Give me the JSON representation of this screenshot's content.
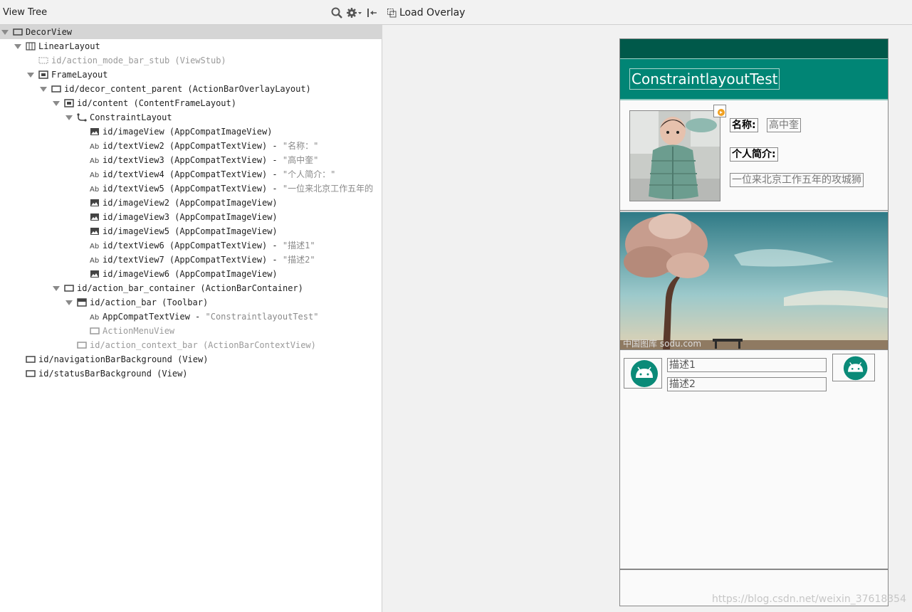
{
  "left_panel": {
    "title": "View Tree"
  },
  "right_panel": {
    "load_overlay_label": "Load Overlay"
  },
  "tree": [
    {
      "indent": 0,
      "arrow": true,
      "icon": "view-icon",
      "label": "DecorView",
      "string": "",
      "dim": false,
      "selected": true
    },
    {
      "indent": 1,
      "arrow": true,
      "icon": "linear-layout-icon",
      "label": "LinearLayout",
      "string": "",
      "dim": false
    },
    {
      "indent": 2,
      "arrow": false,
      "icon": "viewstub-icon",
      "label": "id/action_mode_bar_stub (ViewStub)",
      "string": "",
      "dim": true
    },
    {
      "indent": 2,
      "arrow": true,
      "icon": "frame-layout-icon",
      "label": "FrameLayout",
      "string": "",
      "dim": false
    },
    {
      "indent": 3,
      "arrow": true,
      "icon": "view-icon",
      "label": "id/decor_content_parent (ActionBarOverlayLayout)",
      "string": "",
      "dim": false
    },
    {
      "indent": 4,
      "arrow": true,
      "icon": "frame-layout-icon",
      "label": "id/content (ContentFrameLayout)",
      "string": "",
      "dim": false
    },
    {
      "indent": 5,
      "arrow": true,
      "icon": "constraint-layout-icon",
      "label": "ConstraintLayout",
      "string": "",
      "dim": false
    },
    {
      "indent": 6,
      "arrow": false,
      "icon": "image-icon",
      "label": "id/imageView (AppCompatImageView)",
      "string": "",
      "dim": false
    },
    {
      "indent": 6,
      "arrow": false,
      "icon": "text-icon",
      "label": "id/textView2 (AppCompatTextView) - ",
      "string": "\"名称：\"",
      "dim": false
    },
    {
      "indent": 6,
      "arrow": false,
      "icon": "text-icon",
      "label": "id/textView3 (AppCompatTextView) - ",
      "string": "\"高中奎\"",
      "dim": false
    },
    {
      "indent": 6,
      "arrow": false,
      "icon": "text-icon",
      "label": "id/textView4 (AppCompatTextView) - ",
      "string": "\"个人简介：\"",
      "dim": false
    },
    {
      "indent": 6,
      "arrow": false,
      "icon": "text-icon",
      "label": "id/textView5 (AppCompatTextView) - ",
      "string": "\"一位来北京工作五年的",
      "dim": false
    },
    {
      "indent": 6,
      "arrow": false,
      "icon": "image-icon",
      "label": "id/imageView2 (AppCompatImageView)",
      "string": "",
      "dim": false
    },
    {
      "indent": 6,
      "arrow": false,
      "icon": "image-icon",
      "label": "id/imageView3 (AppCompatImageView)",
      "string": "",
      "dim": false
    },
    {
      "indent": 6,
      "arrow": false,
      "icon": "image-icon",
      "label": "id/imageView5 (AppCompatImageView)",
      "string": "",
      "dim": false
    },
    {
      "indent": 6,
      "arrow": false,
      "icon": "text-icon",
      "label": "id/textView6 (AppCompatTextView) - ",
      "string": "\"描述1\"",
      "dim": false
    },
    {
      "indent": 6,
      "arrow": false,
      "icon": "text-icon",
      "label": "id/textView7 (AppCompatTextView) - ",
      "string": "\"描述2\"",
      "dim": false
    },
    {
      "indent": 6,
      "arrow": false,
      "icon": "image-icon",
      "label": "id/imageView6 (AppCompatImageView)",
      "string": "",
      "dim": false
    },
    {
      "indent": 4,
      "arrow": true,
      "icon": "view-icon",
      "label": "id/action_bar_container (ActionBarContainer)",
      "string": "",
      "dim": false
    },
    {
      "indent": 5,
      "arrow": true,
      "icon": "toolbar-icon",
      "label": "id/action_bar (Toolbar)",
      "string": "",
      "dim": false
    },
    {
      "indent": 6,
      "arrow": false,
      "icon": "text-icon",
      "label": "AppCompatTextView - ",
      "string": "\"ConstraintlayoutTest\"",
      "dim": false
    },
    {
      "indent": 6,
      "arrow": false,
      "icon": "view-icon",
      "label": "ActionMenuView",
      "string": "",
      "dim": true
    },
    {
      "indent": 5,
      "arrow": false,
      "icon": "view-icon",
      "label": "id/action_context_bar (ActionBarContextView)",
      "string": "",
      "dim": true
    },
    {
      "indent": 1,
      "arrow": false,
      "icon": "view-icon",
      "label": "id/navigationBarBackground (View)",
      "string": "",
      "dim": false
    },
    {
      "indent": 1,
      "arrow": false,
      "icon": "view-icon",
      "label": "id/statusBarBackground (View)",
      "string": "",
      "dim": false
    }
  ],
  "device": {
    "toolbar_title": "ConstraintlayoutTest",
    "name_label": "名称:",
    "name_value": "高中奎",
    "intro_label": "个人简介:",
    "intro_value": "一位来北京工作五年的攻城狮",
    "banner_watermark": "中国图库 sodu.com",
    "desc1": "描述1",
    "desc2": "描述2",
    "colors": {
      "status_bar": "#00594a",
      "toolbar": "#018575",
      "droid": "#0a8a78"
    }
  },
  "watermark": "https://blog.csdn.net/weixin_37618354"
}
